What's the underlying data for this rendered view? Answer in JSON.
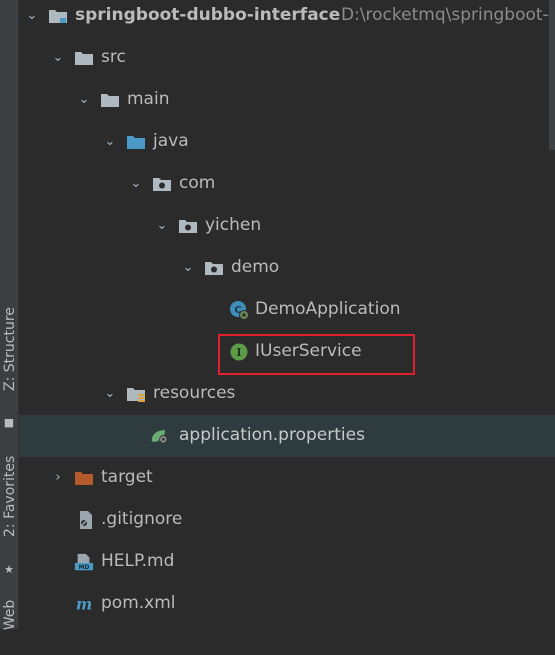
{
  "sidebar": {
    "tabs": [
      {
        "label": "Z: Structure",
        "icon": "structure-icon"
      },
      {
        "label": "2: Favorites",
        "icon": "star-icon"
      },
      {
        "label": "Web",
        "icon": "web-icon"
      }
    ]
  },
  "tree": {
    "project": {
      "name": "springboot-dubbo-interface",
      "path": "D:\\rocketmq\\springboot-"
    },
    "nodes": [
      {
        "label": "src",
        "icon": "folder-icon"
      },
      {
        "label": "main",
        "icon": "folder-icon"
      },
      {
        "label": "java",
        "icon": "source-folder-icon"
      },
      {
        "label": "com",
        "icon": "package-icon"
      },
      {
        "label": "yichen",
        "icon": "package-icon"
      },
      {
        "label": "demo",
        "icon": "package-icon"
      },
      {
        "label": "DemoApplication",
        "icon": "spring-boot-class-icon"
      },
      {
        "label": "IUserService",
        "icon": "interface-icon",
        "highlighted": true
      },
      {
        "label": "resources",
        "icon": "resources-folder-icon"
      },
      {
        "label": "application.properties",
        "icon": "spring-properties-icon",
        "selected": true
      },
      {
        "label": "target",
        "icon": "excluded-folder-icon"
      },
      {
        "label": ".gitignore",
        "icon": "gitignore-file-icon"
      },
      {
        "label": "HELP.md",
        "icon": "markdown-file-icon"
      },
      {
        "label": "pom.xml",
        "icon": "maven-pom-icon"
      }
    ]
  },
  "colors": {
    "background": "#2b2b2b",
    "selection": "#2e3c3f",
    "text": "#bbbbbb",
    "highlight_box": "#e0212b",
    "folder": "#aeb9c0",
    "source_folder": "#4a9ac8",
    "target_folder": "#b55a2a"
  }
}
